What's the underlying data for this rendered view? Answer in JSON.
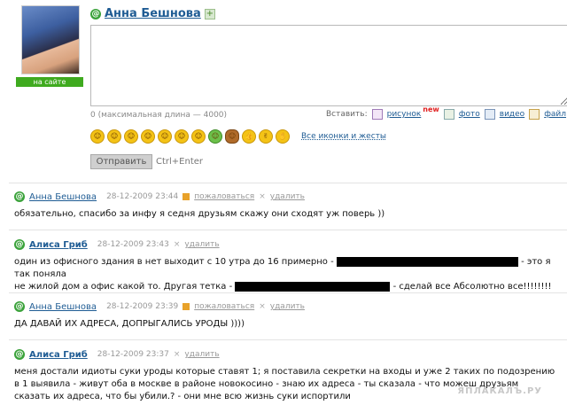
{
  "profile": {
    "online_label": "на сайте",
    "name": "Анна Бешнова"
  },
  "composer": {
    "max_length": "0 (максимальная длина — 4000)",
    "insert_label": "Вставить:",
    "insert_items": [
      "рисунок",
      "фото",
      "видео",
      "файл"
    ],
    "new_badge": "new",
    "smileys": [
      "smile",
      "grin",
      "tongue",
      "laugh",
      "wink",
      "cool",
      "sick",
      "green-face",
      "devil",
      "thumbs-up",
      "peace",
      "ok-hand"
    ],
    "all_icons_link": "Все иконки и жесты",
    "send_label": "Отправить",
    "shortcut": "Ctrl+Enter"
  },
  "comments": [
    {
      "author": "Анна Бешнова",
      "date": "28-12-2009 23:44",
      "complain": "пожаловаться",
      "delete": "удалить",
      "text": "обязательно, спасибо за инфу я седня друзьям скажу они сходят уж поверь ))"
    },
    {
      "author": "Алиса Гриб",
      "date": "28-12-2009 23:43",
      "delete": "удалить",
      "text_a": "один из офисного здания в нет выходит с 10 утра до 16 примерно -",
      "text_b": "- это я так поняла",
      "text_c": "не жилой дом а офис какой то. Другая тетка -",
      "text_d": "- сделай все Абсолютно все!!!!!!!!"
    },
    {
      "author": "Анна Бешнова",
      "date": "28-12-2009 23:39",
      "complain": "пожаловаться",
      "delete": "удалить",
      "text": "ДА ДАВАЙ ИХ АДРЕСА, ДОПРЫГАЛИСЬ УРОДЫ ))))"
    },
    {
      "author": "Алиса Гриб",
      "date": "28-12-2009 23:37",
      "delete": "удалить",
      "text": "меня достали идиоты суки уроды которые ставят 1; я поставила секретки на входы и уже 2 таких по подозрению в 1 выявила - живут оба в москве в районе новокосино - знаю их адреса - ты сказала - что можеш друзьям сказать их адреса, что бы убили.? - они мне всю жизнь суки испортили"
    }
  ],
  "watermark": "ЯПЛАКАЛЪ.РУ"
}
